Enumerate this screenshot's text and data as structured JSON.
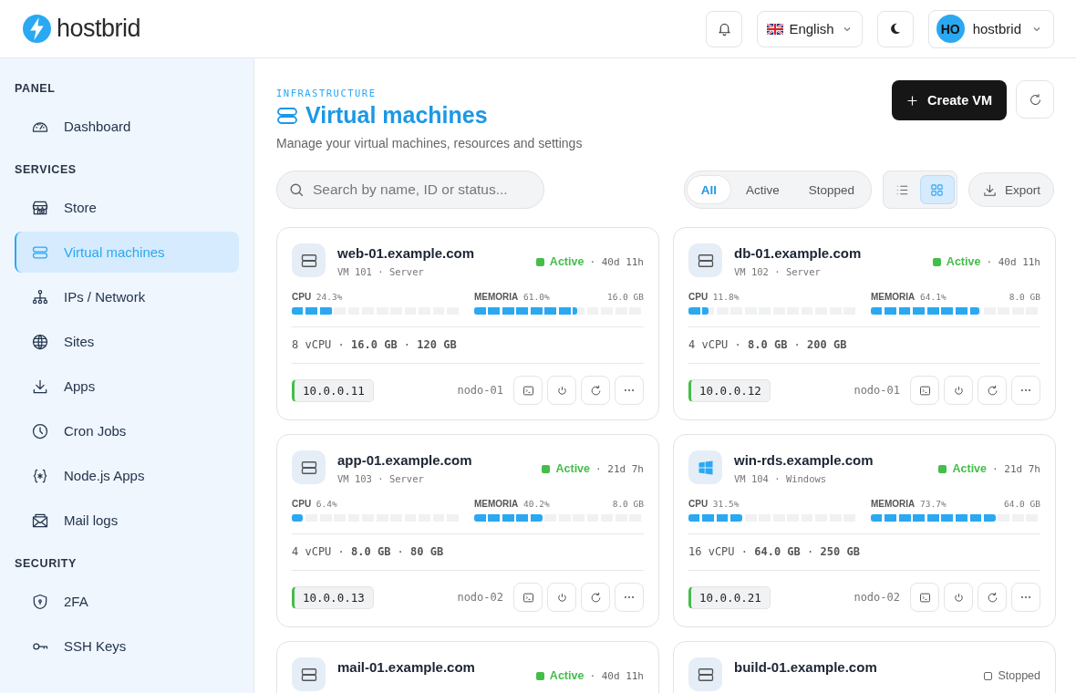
{
  "header": {
    "logo": "**host**brid",
    "language": "English",
    "user": {
      "initials": "HO",
      "name": "hostbrid"
    }
  },
  "sidebar": [
    {
      "title": "PANEL",
      "items": [
        {
          "label": "Dashboard",
          "selected": false
        }
      ]
    },
    {
      "title": "SERVICES",
      "items": [
        {
          "label": "Store",
          "selected": false
        },
        {
          "label": "Virtual machines",
          "selected": true
        },
        {
          "label": "IPs / Network",
          "selected": false
        },
        {
          "label": "Sites",
          "selected": false
        },
        {
          "label": "Apps",
          "selected": false
        },
        {
          "label": "Cron Jobs",
          "selected": false
        },
        {
          "label": "Node.js Apps",
          "selected": false
        },
        {
          "label": "Mail logs",
          "selected": false
        }
      ]
    },
    {
      "title": "SECURITY",
      "items": [
        {
          "label": "2FA",
          "selected": false
        },
        {
          "label": "SSH Keys",
          "selected": false
        }
      ]
    }
  ],
  "page": {
    "eyebrow": "INFRASTRUCTURE",
    "title": "Virtual machines",
    "subtitle": "Manage your virtual machines, resources and settings",
    "create_button": "Create VM"
  },
  "toolbar": {
    "search": {
      "placeholder": "Search by name, ID or status..."
    },
    "filters": [
      {
        "label": "All",
        "selected": true
      },
      {
        "label": "Active",
        "selected": false
      },
      {
        "label": "Stopped",
        "selected": false
      }
    ],
    "views": [
      {
        "kind": "list",
        "selected": false
      },
      {
        "kind": "grid",
        "selected": true
      }
    ],
    "export": "Export"
  },
  "vms": [
    {
      "kind": "server",
      "name": "web-01.example.com",
      "subtitle": "VM 101 · Server",
      "status": {
        "kind": "active",
        "label": "Active"
      },
      "uptime": "· 40d 11h",
      "cpu": {
        "label": "CPU",
        "value": "24.3%",
        "level": 0.243
      },
      "memory": {
        "label": "MEMORIA",
        "value": "61.0%",
        "total": "16.0 GB",
        "level": 0.61
      },
      "specs": "8 vCPU · **16.0 GB** · **120 GB**",
      "ip": "10.0.0.11",
      "node": "nodo-01"
    },
    {
      "kind": "server",
      "name": "db-01.example.com",
      "subtitle": "VM 102 · Server",
      "status": {
        "kind": "active",
        "label": "Active"
      },
      "uptime": "· 40d 11h",
      "cpu": {
        "label": "CPU",
        "value": "11.8%",
        "level": 0.118
      },
      "memory": {
        "label": "MEMORIA",
        "value": "64.1%",
        "total": "8.0 GB",
        "level": 0.641
      },
      "specs": "4 vCPU · **8.0 GB** · **200 GB**",
      "ip": "10.0.0.12",
      "node": "nodo-01"
    },
    {
      "kind": "server",
      "name": "app-01.example.com",
      "subtitle": "VM 103 · Server",
      "status": {
        "kind": "active",
        "label": "Active"
      },
      "uptime": "· 21d 7h",
      "cpu": {
        "label": "CPU",
        "value": "6.4%",
        "level": 0.064
      },
      "memory": {
        "label": "MEMORIA",
        "value": "40.2%",
        "total": "8.0 GB",
        "level": 0.402
      },
      "specs": "4 vCPU · **8.0 GB** · **80 GB**",
      "ip": "10.0.0.13",
      "node": "nodo-02"
    },
    {
      "kind": "windows",
      "name": "win-rds.example.com",
      "subtitle": "VM 104 · Windows",
      "status": {
        "kind": "active",
        "label": "Active"
      },
      "uptime": "· 21d 7h",
      "cpu": {
        "label": "CPU",
        "value": "31.5%",
        "level": 0.315
      },
      "memory": {
        "label": "MEMORIA",
        "value": "73.7%",
        "total": "64.0 GB",
        "level": 0.737
      },
      "specs": "16 vCPU · **64.0 GB** · **250 GB**",
      "ip": "10.0.0.21",
      "node": "nodo-02"
    },
    {
      "kind": "server",
      "name": "mail-01.example.com",
      "status": {
        "kind": "active",
        "label": "Active"
      },
      "uptime": "· 40d 11h"
    },
    {
      "kind": "server",
      "name": "build-01.example.com",
      "status": {
        "kind": "stopped",
        "label": "Stopped"
      }
    }
  ]
}
